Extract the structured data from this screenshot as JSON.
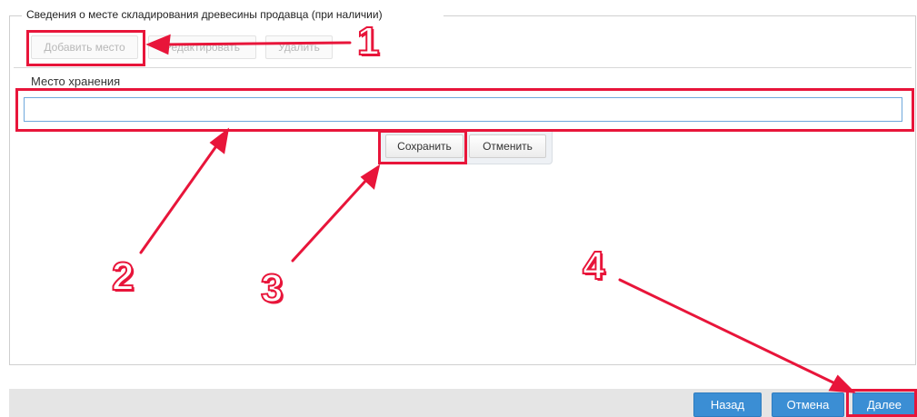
{
  "section": {
    "legend": "Сведения о месте складирования древесины продавца (при наличии)"
  },
  "toolbar": {
    "add_label": "Добавить место",
    "edit_label": "Редактировать",
    "delete_label": "Удалить"
  },
  "form": {
    "field_label": "Место хранения",
    "field_value": "",
    "save_label": "Сохранить",
    "cancel_label": "Отменить"
  },
  "footer": {
    "back_label": "Назад",
    "cancel_label": "Отмена",
    "next_label": "Далее"
  },
  "annotations": {
    "step1": "1",
    "step2": "2",
    "step3": "3",
    "step4": "4",
    "highlight_color": "#e8153a"
  },
  "colors": {
    "primary_button": "#3b8ed4",
    "input_border": "#6fa8dc"
  }
}
